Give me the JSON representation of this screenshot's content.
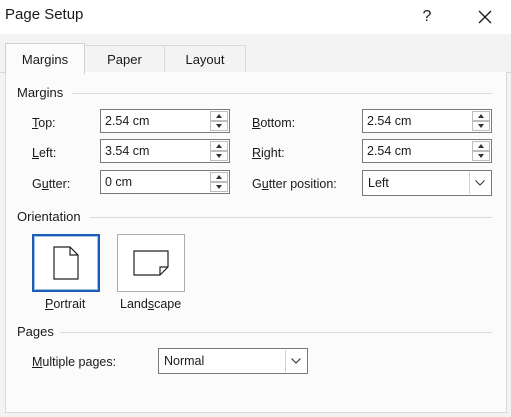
{
  "window": {
    "title": "Page Setup",
    "help_glyph": "?",
    "close_glyph": "✕"
  },
  "tabs": [
    {
      "label": "Margins",
      "active": true
    },
    {
      "label": "Paper",
      "active": false
    },
    {
      "label": "Layout",
      "active": false
    }
  ],
  "margins": {
    "group_title": "Margins",
    "top": {
      "label_u": "T",
      "label_rest": "op:",
      "value": "2.54 cm"
    },
    "bottom": {
      "label_u": "B",
      "label_rest": "ottom:",
      "value": "2.54 cm"
    },
    "left": {
      "label_u": "L",
      "label_rest": "eft:",
      "value": "3.54 cm"
    },
    "right": {
      "label_u": "R",
      "label_rest": "ight:",
      "value": "2.54 cm"
    },
    "gutter": {
      "label_pre": "G",
      "label_u": "u",
      "label_rest": "tter:",
      "value": "0 cm"
    },
    "gutter_position": {
      "label_pre": "G",
      "label_u": "u",
      "label_rest": "tter position:",
      "value": "Left"
    }
  },
  "orientation": {
    "group_title": "Orientation",
    "portrait": {
      "label_u": "P",
      "label_rest": "ortrait",
      "selected": true
    },
    "landscape": {
      "label_pre": "Land",
      "label_u": "s",
      "label_rest": "cape",
      "selected": false
    }
  },
  "pages": {
    "group_title": "Pages",
    "multiple_pages": {
      "label_u": "M",
      "label_rest": "ultiple pages:",
      "value": "Normal"
    }
  },
  "colors": {
    "accent": "#1a5fb4",
    "panel_bg": "#fbfbfb",
    "dialog_bg": "#f3f3f3"
  }
}
